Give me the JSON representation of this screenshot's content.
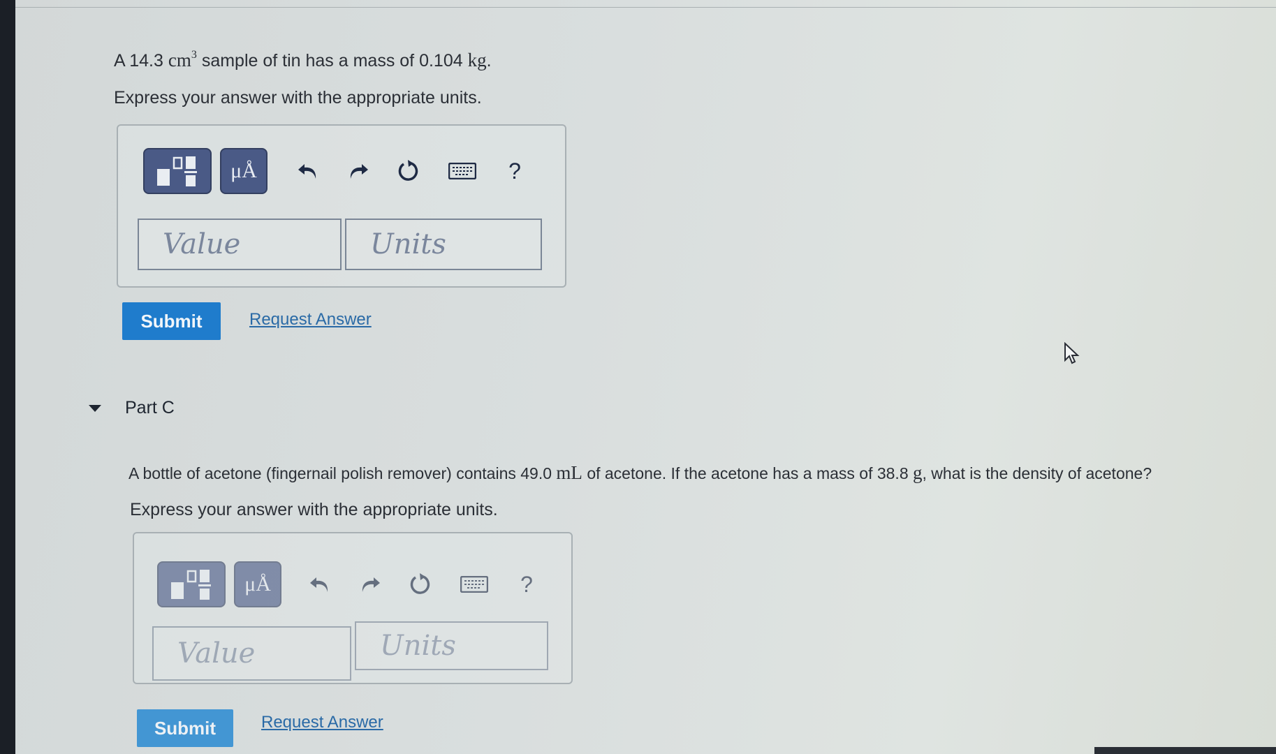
{
  "partB": {
    "question": {
      "prefix": "A 14.3",
      "unit1": "cm",
      "unit1_exp": "3",
      "middle": "sample of tin has a mass of 0.104",
      "unit2": "kg",
      "suffix": "."
    },
    "instruction": "Express your answer with the appropriate units.",
    "toolbar": {
      "templates_icon": "fraction-template-icon",
      "units_label": "μÅ",
      "undo_icon": "undo-icon",
      "redo_icon": "redo-icon",
      "reset_icon": "reset-icon",
      "keyboard_icon": "keyboard-icon",
      "help_label": "?"
    },
    "value_placeholder": "Value",
    "units_placeholder": "Units",
    "submit_label": "Submit",
    "request_answer_label": "Request Answer"
  },
  "partC": {
    "label": "Part C",
    "question": {
      "prefix": "A bottle of acetone (fingernail polish remover) contains 49.0",
      "unit1": "mL",
      "middle": "of acetone. If the acetone has a mass of 38.8",
      "unit2": "g",
      "suffix": ", what is the density of acetone?"
    },
    "instruction": "Express your answer with the appropriate units.",
    "toolbar": {
      "templates_icon": "fraction-template-icon",
      "units_label": "μÅ",
      "undo_icon": "undo-icon",
      "redo_icon": "redo-icon",
      "reset_icon": "reset-icon",
      "keyboard_icon": "keyboard-icon",
      "help_label": "?"
    },
    "value_placeholder": "Value",
    "units_placeholder": "Units",
    "submit_label": "Submit",
    "request_answer_label": "Request Answer"
  },
  "colors": {
    "submit_bg": "#1f7ccc",
    "link": "#2a6aa6",
    "toolbar_button": "#4a5a86"
  }
}
